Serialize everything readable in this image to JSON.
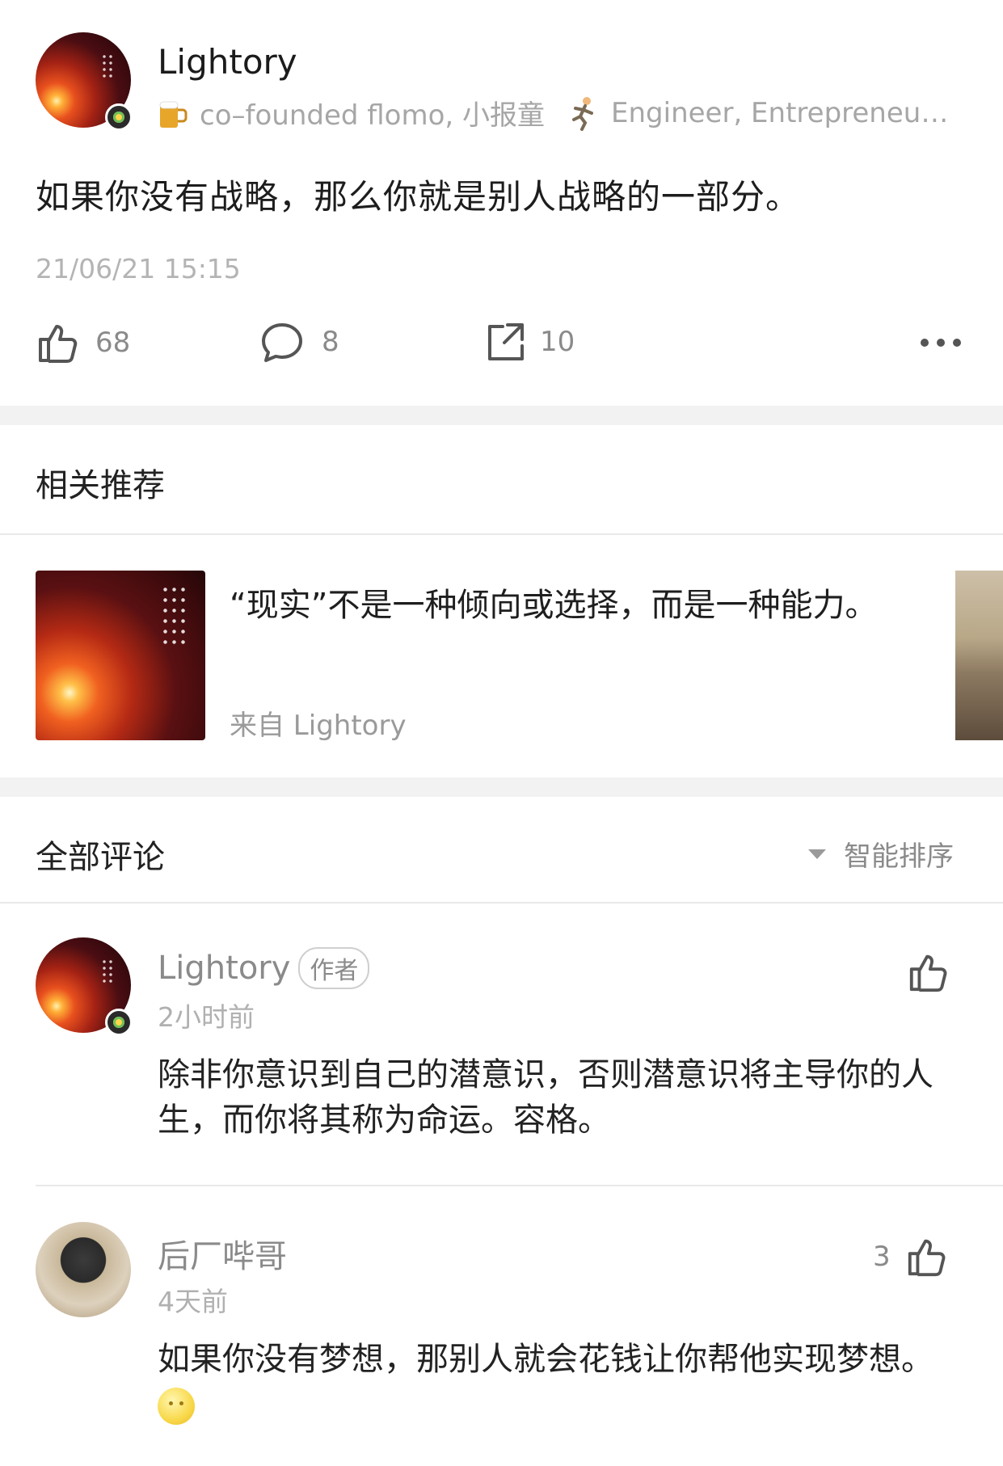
{
  "post": {
    "author_name": "Lightory",
    "bio_part1": "co–founded flomo, 小报童",
    "bio_part2": "Engineer, Entrepreneu…",
    "bio_icon1": "beer-mug-icon",
    "bio_icon2": "person-running-icon",
    "content": "如果你没有战略，那么你就是别人战略的一部分。",
    "timestamp": "21/06/21 15:15",
    "likes": "68",
    "comments": "8",
    "shares": "10"
  },
  "recommend": {
    "title": "相关推荐",
    "items": [
      {
        "text": "“现实”不是一种倾向或选择，而是一种能力。",
        "from": "来自 Lightory"
      }
    ]
  },
  "comments_section": {
    "title": "全部评论",
    "sort_label": "智能排序",
    "items": [
      {
        "name": "Lightory",
        "tag": "作者",
        "time": "2小时前",
        "text": "除非你意识到自己的潜意识，否则潜意识将主导你的人生，而你将其称为命运。容格。",
        "likes": ""
      },
      {
        "name": "后厂哔哥",
        "time": "4天前",
        "text": "如果你没有梦想，那别人就会花钱让你帮他实现梦想。",
        "likes": "3"
      }
    ]
  },
  "colors": {
    "background": "#ffffff",
    "separator": "#f2f2f2",
    "muted_text": "#a6a6a6"
  }
}
